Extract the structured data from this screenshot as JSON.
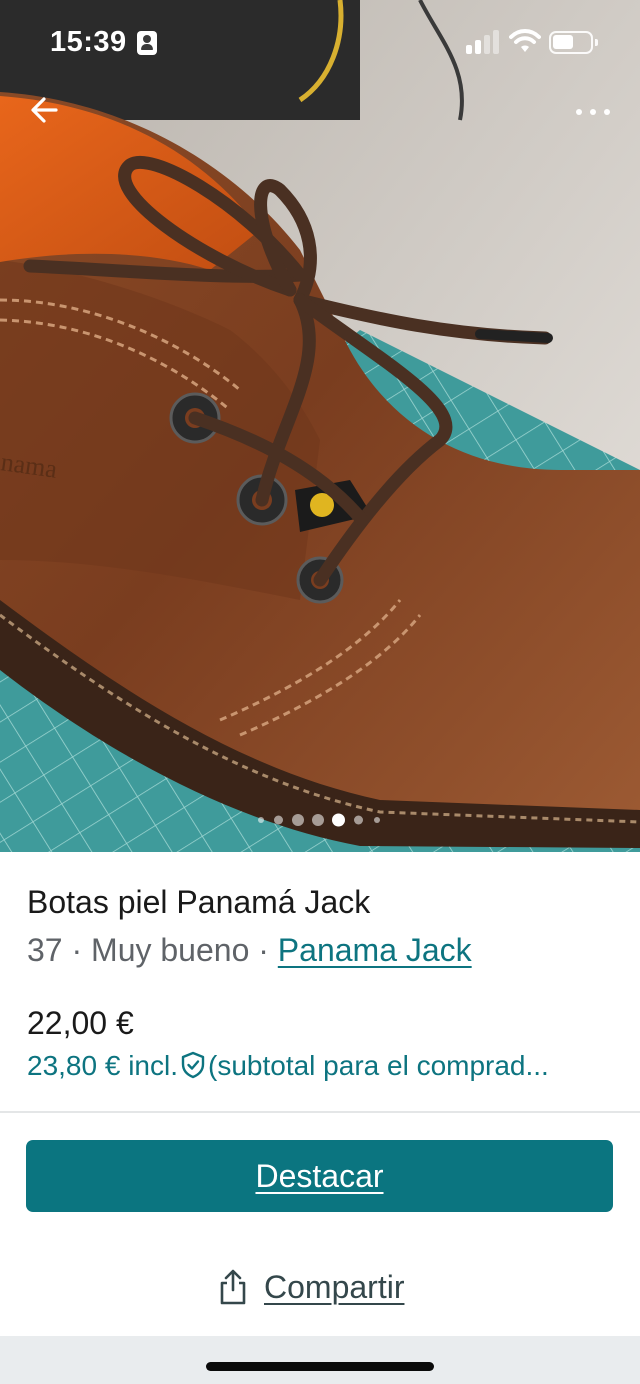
{
  "status_bar": {
    "time": "15:39",
    "icons": [
      "person-badge-icon",
      "cellular-signal-icon",
      "wifi-icon",
      "battery-icon"
    ]
  },
  "nav": {
    "back_icon": "arrow-left-icon",
    "more_icon": "more-horizontal-icon"
  },
  "gallery": {
    "image": "brown leather lace-up ankle boot on a teal cutting mat",
    "dot_count": 7,
    "active_dot": 5
  },
  "listing": {
    "title": "Botas piel Panamá Jack",
    "size": "37",
    "separator": " · ",
    "condition": "Muy bueno",
    "brand": "Panama Jack",
    "price": "22,00 €",
    "buyer_price_amount": "23,80 € incl.",
    "buyer_price_icon": "shield-check-icon",
    "buyer_price_note": "(subtotal para el comprad..."
  },
  "actions": {
    "bump_label": "Destacar",
    "share_label": "Compartir",
    "share_icon": "share-icon"
  },
  "colors": {
    "accent": "#0b7580",
    "link": "#0d7480",
    "muted_text": "#5f6368",
    "text": "#1a1a1a"
  }
}
